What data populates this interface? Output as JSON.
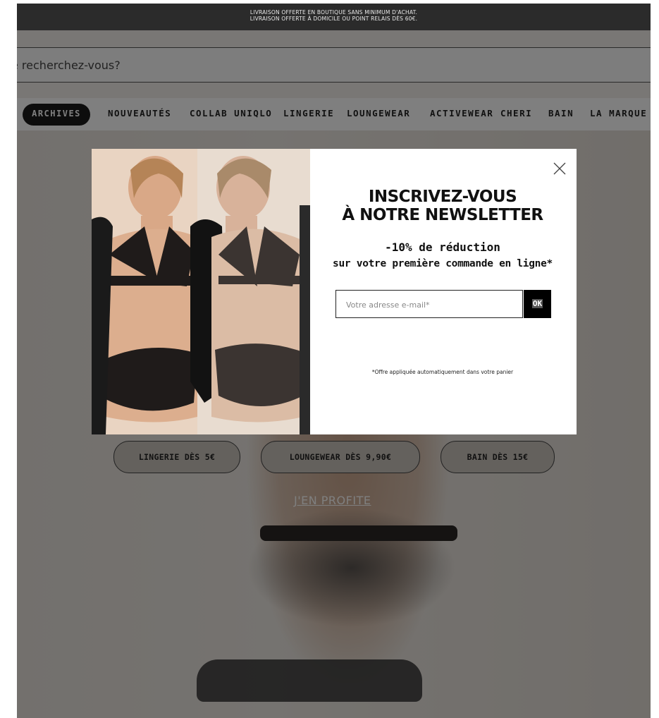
{
  "top_banner": {
    "line1": "LIVRAISON OFFERTE EN BOUTIQUE SANS MINIMUM D'ACHAT.",
    "line2": "LIVRAISON OFFERTE À DOMICILE OU POINT RELAIS DÈS 60€."
  },
  "search": {
    "placeholder": "e recherchez-vous?"
  },
  "nav": {
    "items": [
      {
        "label": "ARCHIVES",
        "active": true
      },
      {
        "label": "NOUVEAUTÉS"
      },
      {
        "label": "COLLAB UNIQLO"
      },
      {
        "label": "LINGERIE"
      },
      {
        "label": "LOUNGEWEAR"
      },
      {
        "label": "ACTIVEWEAR"
      },
      {
        "label": "CHERI"
      },
      {
        "label": "BAIN"
      },
      {
        "label": "LA MARQUE"
      }
    ]
  },
  "hero": {
    "buttons": [
      "LINGERIE DÈS 5€",
      "LOUNGEWEAR DÈS 9,90€",
      "BAIN DÈS 15€"
    ],
    "link": "J'EN PROFITE"
  },
  "modal": {
    "title_line1": "INSCRIVEZ-VOUS",
    "title_line2": "À NOTRE NEWSLETTER",
    "discount": "-10% de réduction",
    "discount_detail": "sur votre première commande en ligne*",
    "email_placeholder": "Votre adresse e-mail*",
    "submit_label": "OK",
    "note": "*Offre appliquée automatiquement dans votre panier",
    "close_icon": "close-icon"
  },
  "colors": {
    "banner_bg": "#2b2b2b",
    "accent": "#000000",
    "overlay": "rgba(0,0,0,0.5)"
  }
}
